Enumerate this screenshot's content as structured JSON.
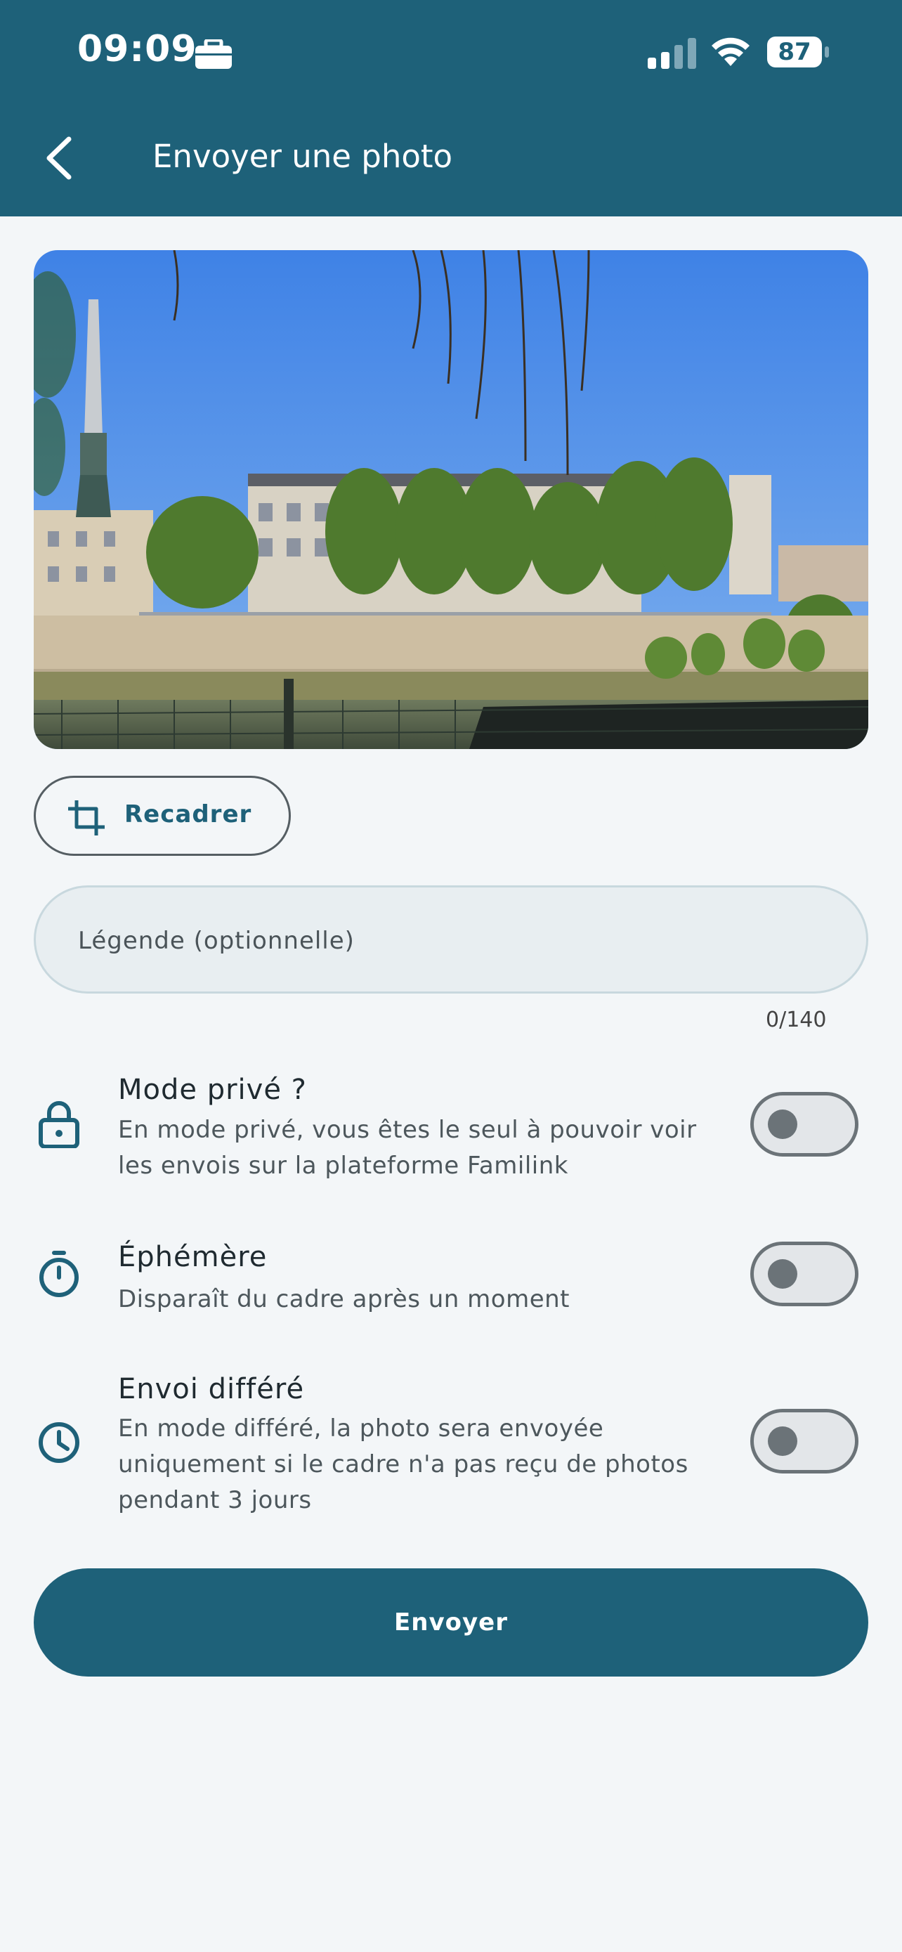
{
  "status_bar": {
    "time": "09:09",
    "battery": "87",
    "icons": [
      "briefcase-icon",
      "signal-icon",
      "wifi-icon",
      "battery-icon"
    ]
  },
  "header": {
    "back_icon": "chevron-left-icon",
    "title": "Envoyer une photo"
  },
  "photo": {
    "description_icon": "photo-preview"
  },
  "crop": {
    "label": "Recadrer",
    "icon": "crop-icon"
  },
  "caption": {
    "placeholder": "Légende (optionnelle)",
    "value": "",
    "counter": "0/140"
  },
  "options": [
    {
      "icon": "lock-icon",
      "title": "Mode privé ?",
      "desc_lines": [
        "En mode privé, vous êtes le seul à pouvoir voir",
        "les envois sur la plateforme Familink"
      ],
      "enabled": false
    },
    {
      "icon": "timer-icon",
      "title": "Éphémère",
      "desc_lines": [
        "Disparaît du cadre après un moment"
      ],
      "enabled": false
    },
    {
      "icon": "clock-icon",
      "title": "Envoi différé",
      "desc_lines": [
        "En mode différé, la photo sera envoyée",
        "uniquement si le cadre n'a pas reçu de photos",
        "pendant 3 jours"
      ],
      "enabled": false
    }
  ],
  "send": {
    "label": "Envoyer"
  },
  "colors": {
    "primary": "#1e6179",
    "background": "#f3f6f8",
    "field_bg": "#e8eef1"
  }
}
